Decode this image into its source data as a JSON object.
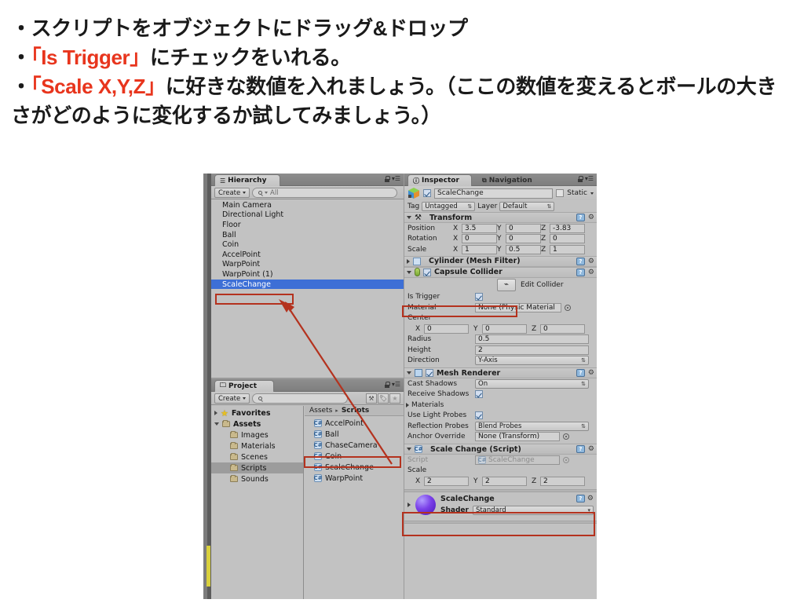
{
  "slide": {
    "line1": "・スクリプトをオブジェクトにドラッグ&ドロップ",
    "line2_bullet": "・",
    "line2_accent": "「Is Trigger」",
    "line2_rest": "にチェックをいれる。",
    "line3_bullet": "・",
    "line3_accent": "「Scale X,Y,Z」",
    "line3_rest": "に好きな数値を入れましょう。（ここの数値を変え",
    "line4": "るとボールの大きさがどのように変化するか試してみましょう。）",
    "accent_color": "#e8351d"
  },
  "hierarchy": {
    "tab_label": "Hierarchy",
    "tab_icon": "hierarchy-icon",
    "create_label": "Create",
    "search_placeholder": "All",
    "search_value": "",
    "items": [
      {
        "label": "Main Camera",
        "selected": false
      },
      {
        "label": "Directional Light",
        "selected": false
      },
      {
        "label": "Floor",
        "selected": false
      },
      {
        "label": "Ball",
        "selected": false
      },
      {
        "label": "Coin",
        "selected": false
      },
      {
        "label": "AccelPoint",
        "selected": false
      },
      {
        "label": "WarpPoint",
        "selected": false
      },
      {
        "label": "WarpPoint (1)",
        "selected": false
      },
      {
        "label": "ScaleChange",
        "selected": true
      }
    ]
  },
  "project": {
    "tab_label": "Project",
    "create_label": "Create",
    "search_value": "",
    "toolbar_icons": [
      "favorites-filter-icon",
      "label-filter-icon",
      "star-filter-icon"
    ],
    "tree": [
      {
        "label": "Favorites",
        "kind": "star",
        "indent": 0,
        "selected": false,
        "twist": "closed"
      },
      {
        "label": "Assets",
        "kind": "folder",
        "indent": 0,
        "selected": false,
        "twist": "open"
      },
      {
        "label": "Images",
        "kind": "folder",
        "indent": 1,
        "selected": false,
        "twist": "none"
      },
      {
        "label": "Materials",
        "kind": "folder",
        "indent": 1,
        "selected": false,
        "twist": "none"
      },
      {
        "label": "Scenes",
        "kind": "folder",
        "indent": 1,
        "selected": false,
        "twist": "none"
      },
      {
        "label": "Scripts",
        "kind": "folder",
        "indent": 1,
        "selected": true,
        "twist": "none"
      },
      {
        "label": "Sounds",
        "kind": "folder",
        "indent": 1,
        "selected": false,
        "twist": "none"
      }
    ],
    "breadcrumb_root": "Assets",
    "breadcrumb_sep": "▸",
    "breadcrumb_current": "Scripts",
    "assets": [
      {
        "label": "AccelPoint",
        "highlighted": false
      },
      {
        "label": "Ball",
        "highlighted": false
      },
      {
        "label": "ChaseCamera",
        "highlighted": false
      },
      {
        "label": "Coin",
        "highlighted": false
      },
      {
        "label": "ScaleChange",
        "highlighted": true
      },
      {
        "label": "WarpPoint",
        "highlighted": false
      }
    ]
  },
  "inspector": {
    "tab_label": "Inspector",
    "tab2_label": "Navigation",
    "object_name": "ScaleChange",
    "object_enabled": true,
    "static_label": "Static",
    "static_checked": false,
    "tag_label": "Tag",
    "tag_value": "Untagged",
    "layer_label": "Layer",
    "layer_value": "Default",
    "transform": {
      "title": "Transform",
      "rows": [
        {
          "label": "Position",
          "x": "3.5",
          "y": "0",
          "z": "-3.83"
        },
        {
          "label": "Rotation",
          "x": "0",
          "y": "0",
          "z": "0"
        },
        {
          "label": "Scale",
          "x": "1",
          "y": "0.5",
          "z": "1"
        }
      ],
      "axis_x": "X",
      "axis_y": "Y",
      "axis_z": "Z"
    },
    "mesh_filter": {
      "title": "Cylinder (Mesh Filter)"
    },
    "capsule_collider": {
      "title": "Capsule Collider",
      "enabled": true,
      "edit_collider_label": "Edit Collider",
      "is_trigger_label": "Is Trigger",
      "is_trigger_checked": true,
      "material_label": "Material",
      "material_value": "None (Physic Material",
      "center_label": "Center",
      "center_x": "0",
      "center_y": "0",
      "center_z": "0",
      "radius_label": "Radius",
      "radius_value": "0.5",
      "height_label": "Height",
      "height_value": "2",
      "direction_label": "Direction",
      "direction_value": "Y-Axis"
    },
    "mesh_renderer": {
      "title": "Mesh Renderer",
      "enabled": true,
      "cast_shadows_label": "Cast Shadows",
      "cast_shadows_value": "On",
      "receive_shadows_label": "Receive Shadows",
      "receive_shadows_checked": true,
      "materials_label": "Materials",
      "use_light_probes_label": "Use Light Probes",
      "use_light_probes_checked": true,
      "reflection_probes_label": "Reflection Probes",
      "reflection_probes_value": "Blend Probes",
      "anchor_override_label": "Anchor Override",
      "anchor_override_value": "None (Transform)"
    },
    "script_component": {
      "title": "Scale Change (Script)",
      "script_label": "Script",
      "script_value": "ScaleChange",
      "scale_label": "Scale",
      "scale_x": "2",
      "scale_y": "2",
      "scale_z": "2",
      "axis_x": "X",
      "axis_y": "Y",
      "axis_z": "Z"
    },
    "material_component": {
      "title": "ScaleChange",
      "shader_label": "Shader",
      "shader_value": "Standard"
    }
  },
  "annotations": {
    "box_color": "#b4321e",
    "arrow_color": "#b4321e",
    "boxes": [
      "hierarchy-scalechange-box",
      "project-scalechange-box",
      "is-trigger-box",
      "script-scale-box"
    ]
  }
}
